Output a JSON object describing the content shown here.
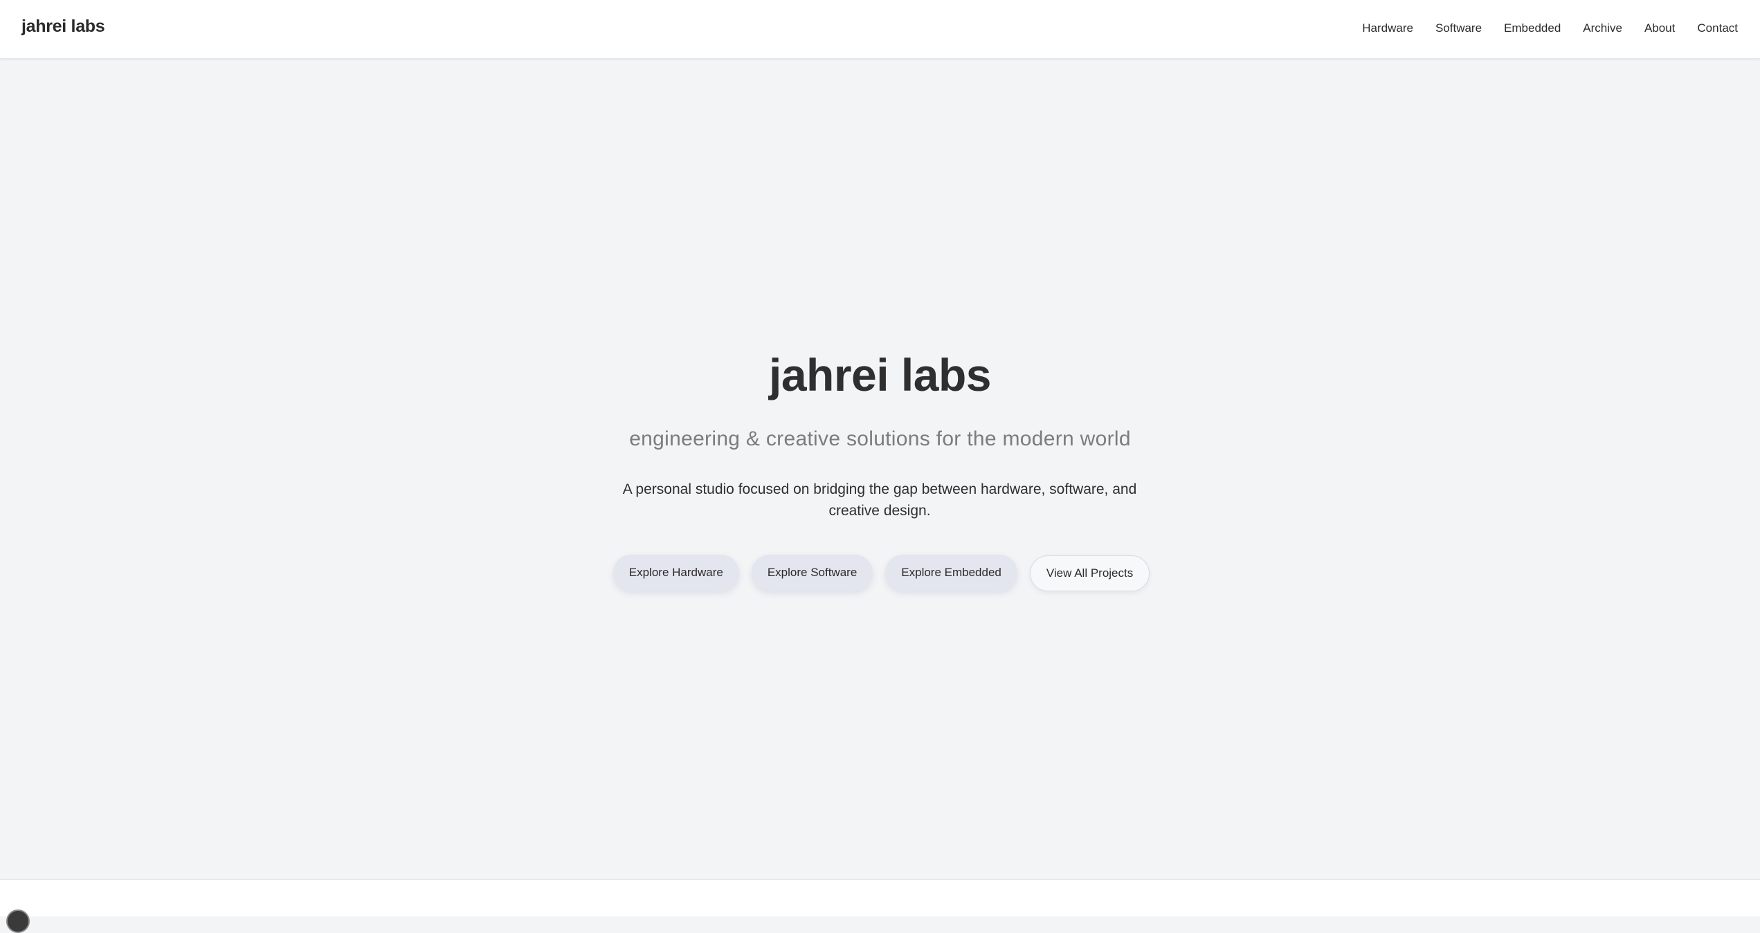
{
  "nav": {
    "brand": "jahrei labs",
    "links": [
      "Hardware",
      "Software",
      "Embedded",
      "Archive",
      "About",
      "Contact"
    ]
  },
  "hero": {
    "title": "jahrei labs",
    "subtitle": "engineering & creative solutions for the modern world",
    "description": "A personal studio focused on bridging the gap between hardware, software, and creative design.",
    "buttons": [
      "Explore Hardware",
      "Explore Software",
      "Explore Embedded",
      "View All Projects"
    ]
  },
  "footer": {
    "icon": "github-icon"
  },
  "colors": {
    "background": "#f3f4f6",
    "navbar": "#ffffff",
    "text": "#2b2b2b",
    "subtitle": "#7c7c7c",
    "soft_button": "#e3e6ef"
  }
}
